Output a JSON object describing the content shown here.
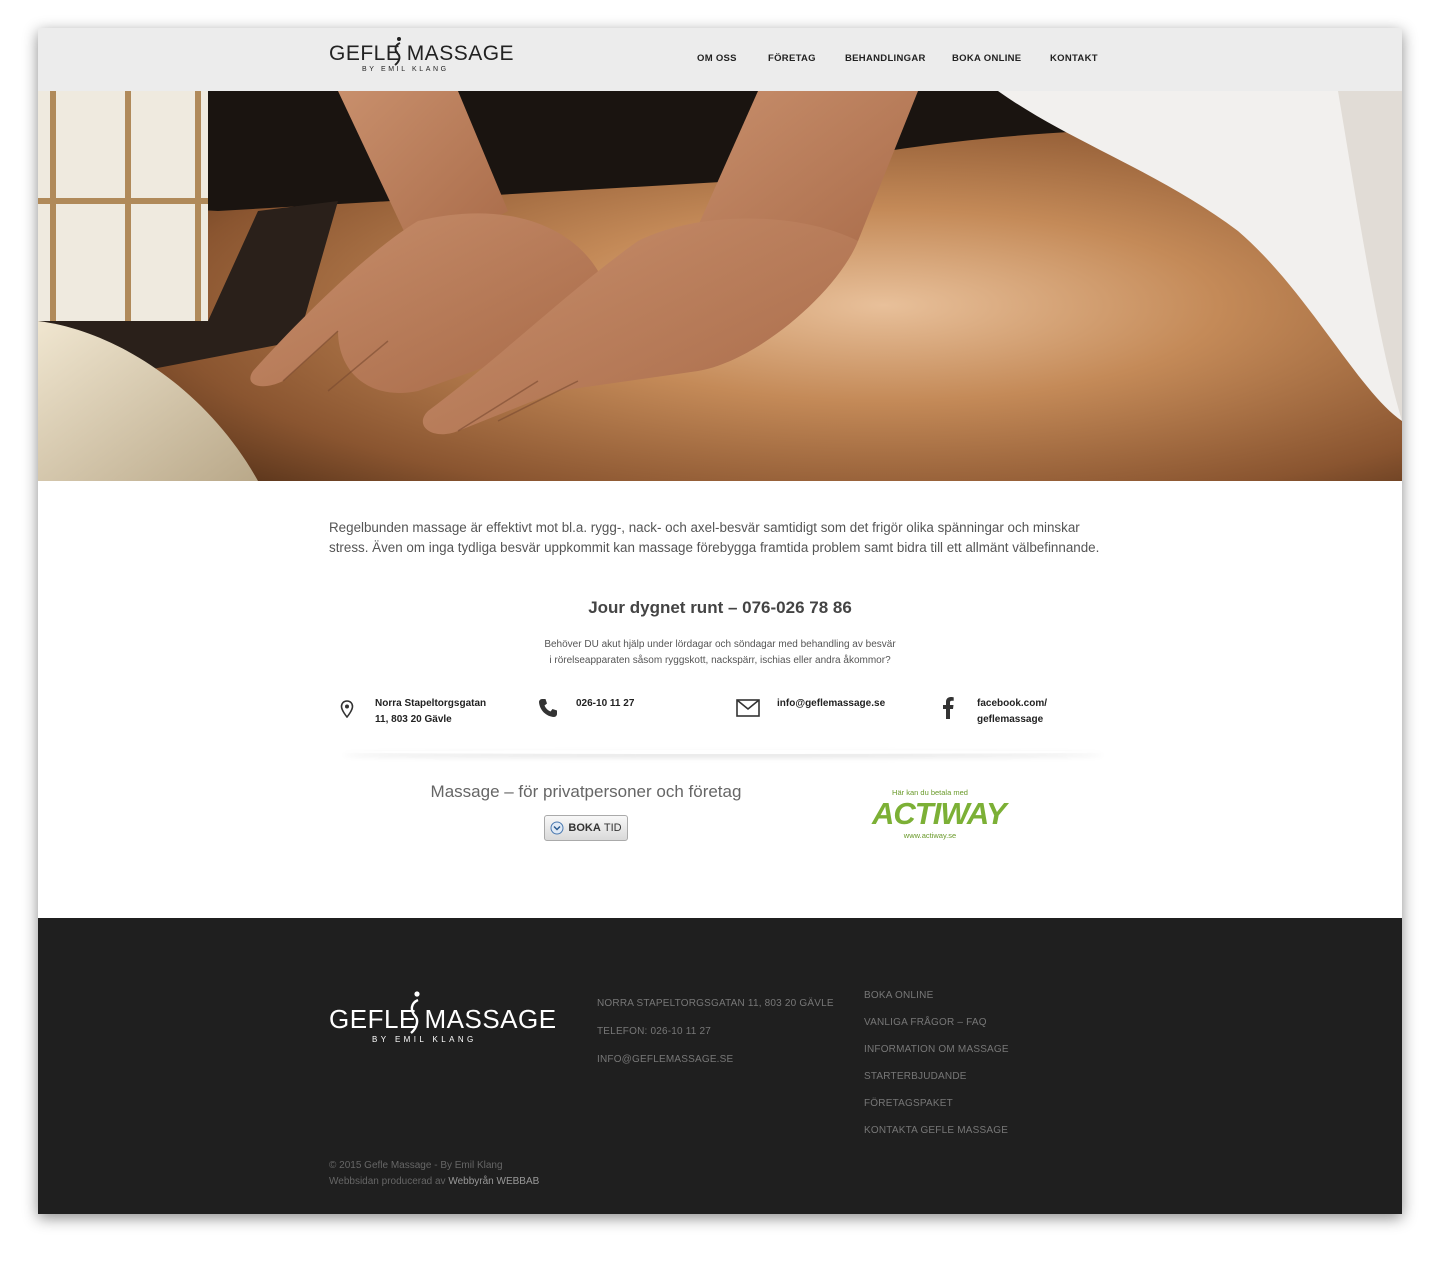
{
  "header": {
    "logo": {
      "main": "GEFLE MASSAGE",
      "sub": "BY EMIL KLANG"
    },
    "nav": [
      {
        "label": "OM OSS"
      },
      {
        "label": "FÖRETAG"
      },
      {
        "label": "BEHANDLINGAR"
      },
      {
        "label": "BOKA ONLINE"
      },
      {
        "label": "KONTAKT"
      }
    ]
  },
  "main": {
    "intro": "Regelbunden massage är effektivt mot bl.a. rygg-, nack- och axel-besvär samtidigt som det frigör olika spänningar och minskar stress. Även om inga tydliga besvär uppkommit kan massage förebygga framtida problem samt bidra till ett allmänt välbefinnande.",
    "jour_title": "Jour dygnet runt – 076-026 78 86",
    "jour_desc_line1": "Behöver DU akut hjälp under lördagar och söndagar med behandling av besvär",
    "jour_desc_line2": "i rörelseapparaten såsom ryggskott, nackspärr, ischias eller andra åkommor?",
    "contacts": [
      {
        "icon": "map-pin-icon",
        "text": "Norra Stapeltorgsgatan\n11, 803 20 Gävle"
      },
      {
        "icon": "phone-icon",
        "text": "026-10 11 27"
      },
      {
        "icon": "envelope-icon",
        "text": "info@geflemassage.se"
      },
      {
        "icon": "facebook-icon",
        "text": "facebook.com/\ngeflemassage"
      }
    ],
    "tagline": "Massage – för privatpersoner och företag",
    "boka_button": {
      "bold": "BOKA",
      "rest": "TID"
    },
    "actiway": {
      "top": "Här kan du betala med",
      "brand": "ACTIWAY",
      "url": "www.actiway.se"
    }
  },
  "footer": {
    "logo": {
      "main": "GEFLE MASSAGE",
      "sub": "BY EMIL KLANG"
    },
    "contact": [
      "NORRA STAPELTORGSGATAN 11, 803 20 GÄVLE",
      "TELEFON: 026-10 11 27",
      "INFO@GEFLEMASSAGE.SE"
    ],
    "links": [
      "BOKA ONLINE",
      "VANLIGA FRÅGOR – FAQ",
      "INFORMATION OM MASSAGE",
      "STARTERBJUDANDE",
      "FÖRETAGSPAKET",
      "KONTAKTA GEFLE MASSAGE"
    ],
    "copyright": "© 2015 Gefle Massage - By Emil Klang",
    "credit_prefix": "Webbsidan producerad av",
    "credit_link": "Webbyrån WEBBAB"
  },
  "colors": {
    "header_bg": "#ececec",
    "footer_bg": "#1f1f1f",
    "actiway_green": "#7cb036"
  }
}
